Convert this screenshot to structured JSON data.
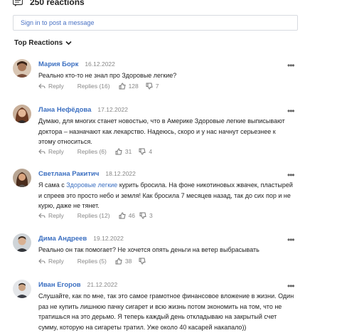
{
  "header": {
    "reactions_count": "250 reactions"
  },
  "signin": {
    "placeholder": "Sign in to post a message"
  },
  "sort": {
    "label": "Top Reactions"
  },
  "actions": {
    "reply": "Reply"
  },
  "comments": [
    {
      "author": "Мария Борк",
      "date": "16.12.2022",
      "text": "Реально кто-то не знал про Здоровые легкие?",
      "replies": "Replies (16)",
      "likes": "128",
      "dislikes": "7"
    },
    {
      "author": "Лана Нефёдова",
      "date": "17.12.2022",
      "text": "Думаю, для многих станет новостью, что в Америке Здоровые легкие выписывают доктора – назначают как лекарство. Надеюсь, скоро и у нас начнут серьезнее к этому относиться.",
      "replies": "Replies (6)",
      "likes": "31",
      "dislikes": "4"
    },
    {
      "author": "Светлана Ракитич",
      "date": "18.12.2022",
      "text_before": "Я сама с ",
      "text_link": "Здоровые легкие",
      "text_after": " курить бросила. На фоне никотиновых жвачек, пластырей и спреев это просто небо и земля! Как бросила 7 месяцев назад, так до сих пор и не курю, даже не тянет.",
      "replies": "Replies (12)",
      "likes": "46",
      "dislikes": "3"
    },
    {
      "author": "Дима Андреев",
      "date": "19.12.2022",
      "text": "Реально он так помогает? Не хочется опять деньги на ветер выбрасывать",
      "replies": "Replies (5)",
      "likes": "38",
      "dislikes": ""
    },
    {
      "author": "Иван Егоров",
      "date": "21.12.2022",
      "text": "Слушайте, как по мне, так это самое грамотное финансовое вложение в жизни. Один раз не купить лишнюю пачку сигарет и всю жизнь потом экономить на том, что не тратишься на это дерьмо. Я теперь каждый день откладываю на закрытый счет сумму, которую на сигареты тратил. Уже около 40 касарей накапало))",
      "replies": "",
      "likes": "",
      "dislikes": ""
    }
  ]
}
